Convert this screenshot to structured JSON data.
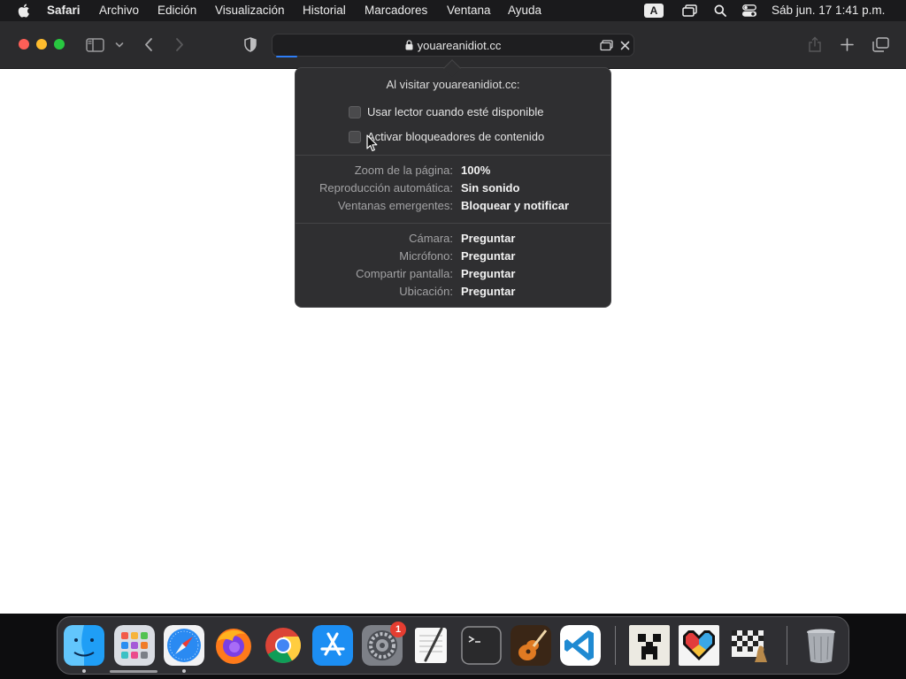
{
  "menubar": {
    "app_name": "Safari",
    "items": [
      "Archivo",
      "Edición",
      "Visualización",
      "Historial",
      "Marcadores",
      "Ventana",
      "Ayuda"
    ],
    "input_source": "A",
    "clock": "Sáb jun. 17  1:41 p.m."
  },
  "browser": {
    "url": "youareanidiot.cc",
    "icons": [
      "sidebar-icon",
      "chevron-down-icon",
      "back-icon",
      "forward-icon",
      "privacy-shield-icon",
      "lock-icon",
      "reader-icon",
      "stop-icon",
      "share-icon",
      "new-tab-icon",
      "tab-overview-icon"
    ]
  },
  "popover": {
    "title": "Al visitar youareanidiot.cc:",
    "checkboxes": [
      {
        "label": "Usar lector cuando esté disponible",
        "checked": false
      },
      {
        "label": "Activar bloqueadores de contenido",
        "checked": false
      }
    ],
    "settings": [
      {
        "key": "Zoom de la página:",
        "value": "100%"
      },
      {
        "key": "Reproducción automática:",
        "value": "Sin sonido"
      },
      {
        "key": "Ventanas emergentes:",
        "value": "Bloquear y notificar"
      }
    ],
    "permissions": [
      {
        "key": "Cámara:",
        "value": "Preguntar"
      },
      {
        "key": "Micrófono:",
        "value": "Preguntar"
      },
      {
        "key": "Compartir pantalla:",
        "value": "Preguntar"
      },
      {
        "key": "Ubicación:",
        "value": "Preguntar"
      }
    ]
  },
  "dock": {
    "apps": [
      "finder-icon",
      "launchpad-icon",
      "safari-icon",
      "firefox-icon",
      "chrome-icon",
      "app-store-icon",
      "system-settings-icon",
      "textedit-icon",
      "terminal-icon",
      "garageband-icon",
      "vscode-icon",
      "creeper-icon",
      "pixel-heart-icon",
      "chess-icon",
      "trash-icon"
    ],
    "settings_badge": "1"
  },
  "colors": {
    "menubar": "#1a1a1c",
    "toolbar": "#2b2b2d",
    "popover": "#2f2f31",
    "accent": "#2e7df6"
  }
}
